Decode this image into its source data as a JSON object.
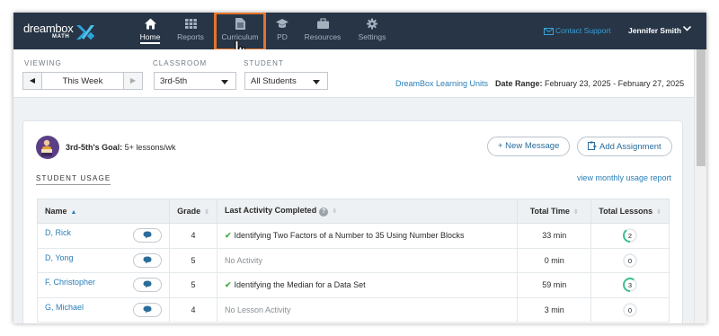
{
  "colors": {
    "nav_bg": "#273546",
    "accent_highlight": "#e3742c",
    "link": "#2a7fb8",
    "success": "#46b04a"
  },
  "nav": {
    "logo_text": "dreambox",
    "logo_sub": "MATH",
    "items": [
      {
        "label": "Home",
        "icon": "home-icon"
      },
      {
        "label": "Reports",
        "icon": "grid-icon"
      },
      {
        "label": "Curriculum",
        "icon": "document-icon"
      },
      {
        "label": "PD",
        "icon": "graduation-cap-icon"
      },
      {
        "label": "Resources",
        "icon": "briefcase-icon"
      },
      {
        "label": "Settings",
        "icon": "gear-icon"
      }
    ],
    "contact_label": "Contact Support",
    "user_name": "Jennifer Smith"
  },
  "filters": {
    "viewing_label": "VIEWING",
    "viewing_value": "This Week",
    "classroom_label": "CLASSROOM",
    "classroom_value": "3rd-5th",
    "student_label": "STUDENT",
    "student_value": "All Students",
    "units_link": "DreamBox Learning Units",
    "date_range_label": "Date Range:",
    "date_range_value": "February 23, 2025 - February 27, 2025"
  },
  "card": {
    "goal_label": "3rd-5th's Goal:",
    "goal_value": "5+ lessons/wk",
    "new_message": "+ New Message",
    "add_assignment": "Add Assignment",
    "usage_title": "STUDENT USAGE",
    "monthly_link": "view monthly usage report"
  },
  "table": {
    "headers": {
      "name": "Name",
      "grade": "Grade",
      "activity": "Last Activity Completed",
      "time": "Total Time",
      "lessons": "Total Lessons"
    },
    "rows": [
      {
        "name": "D, Rick",
        "grade": "4",
        "activity": "Identifying Two Factors of a Number to 35 Using Number Blocks",
        "completed": true,
        "time": "33 min",
        "lessons": 2,
        "progress": 0.4
      },
      {
        "name": "D, Yong",
        "grade": "5",
        "activity": "No Activity",
        "completed": false,
        "time": "0 min",
        "lessons": 0,
        "progress": 0
      },
      {
        "name": "F, Christopher",
        "grade": "5",
        "activity": "Identifying the Median for a Data Set",
        "completed": true,
        "time": "59 min",
        "lessons": 3,
        "progress": 0.6
      },
      {
        "name": "G, Michael",
        "grade": "4",
        "activity": "No Lesson Activity",
        "completed": false,
        "time": "3 min",
        "lessons": 0,
        "progress": 0
      }
    ]
  }
}
